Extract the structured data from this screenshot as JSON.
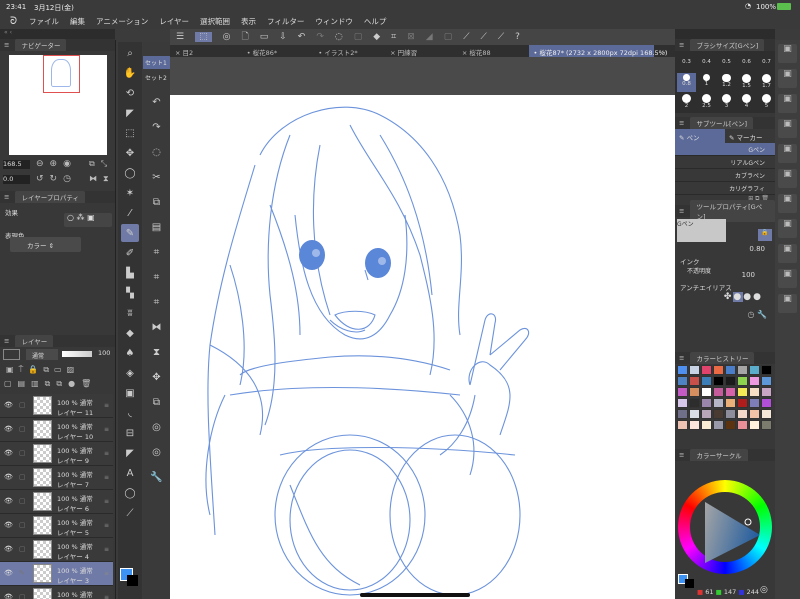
{
  "status": {
    "time": "23:41",
    "date": "3月12日(金)",
    "battery": "100%"
  },
  "menu": [
    "ファイル",
    "編集",
    "アニメーション",
    "レイヤー",
    "選択範囲",
    "表示",
    "フィルター",
    "ウィンドウ",
    "ヘルプ"
  ],
  "tabs": [
    {
      "label": "目2",
      "close": "×"
    },
    {
      "label": "桜花86*",
      "close": "•"
    },
    {
      "label": "イラスト2*",
      "close": "•"
    },
    {
      "label": "円練習",
      "close": "×"
    },
    {
      "label": "桜花88",
      "close": "×"
    },
    {
      "label": "桜花87* (2732 x 2800px 72dpi 168.5%)",
      "close": "•",
      "active": true
    }
  ],
  "navigator": {
    "title": "ナビゲーター",
    "zoom": "168.5",
    "angle": "0.0"
  },
  "layer_property": {
    "title": "レイヤープロパティ",
    "effect_label": "効果",
    "color_label": "表現色",
    "color_value": "カラー"
  },
  "layers_panel": {
    "title": "レイヤー",
    "blend": "通常",
    "opacity": "100",
    "layers": [
      {
        "mode": "100 % 通常",
        "name": "レイヤー 11"
      },
      {
        "mode": "100 % 通常",
        "name": "レイヤー 10"
      },
      {
        "mode": "100 % 通常",
        "name": "レイヤー 9"
      },
      {
        "mode": "100 % 通常",
        "name": "レイヤー 7"
      },
      {
        "mode": "100 % 通常",
        "name": "レイヤー 6"
      },
      {
        "mode": "100 % 通常",
        "name": "レイヤー 5"
      },
      {
        "mode": "100 % 通常",
        "name": "レイヤー 4"
      },
      {
        "mode": "100 % 通常",
        "name": "レイヤー 3",
        "selected": true
      },
      {
        "mode": "100 % 通常",
        "name": ""
      }
    ]
  },
  "subtool_sets": [
    "セット1",
    "セット2"
  ],
  "brush_size": {
    "title": "ブラシサイズ[Gペン]",
    "sizes": [
      "0.3",
      "0.4",
      "0.5",
      "0.6",
      "0.7",
      "0.8",
      "1",
      "1.2",
      "1.5",
      "1.7",
      "2",
      "2.5",
      "3",
      "4",
      "5"
    ]
  },
  "subtool": {
    "title": "サブツール[ペン]",
    "tab_pen": "ペン",
    "tab_marker": "マーカー",
    "items": [
      "Gペン",
      "リアルGペン",
      "カブラペン",
      "カリグラフィ"
    ]
  },
  "tool_property": {
    "title": "ツールプロパティ[Gペン]",
    "preview_label": "Gペン",
    "size": "0.80",
    "ink_label": "インク",
    "opacity_label": "不透明度",
    "opacity": "100",
    "aa_label": "アンチエイリアス"
  },
  "color_history": {
    "title": "カラーヒストリー",
    "colors": [
      "#4f8ff0",
      "#c9d3e6",
      "#e0446d",
      "#ea6a45",
      "#4a7ec9",
      "#a6a6a6",
      "#5aaecb",
      "#000000",
      "#4f82c2",
      "#c8504a",
      "#3c7eb7",
      "#000000",
      "#1b1b1b",
      "#8ed34e",
      "#ee9ae0",
      "#5f98d8",
      "#c45ac4",
      "#d88f5f",
      "#ffffff",
      "#c45b9a",
      "#d463a7",
      "#f4ea55",
      "#f6dfc4",
      "#c9a7c4",
      "#d7c8ec",
      "#2d2d2d",
      "#9a86aa",
      "#b5b5c8",
      "#e9b07a",
      "#b01d1d",
      "#7d7db8",
      "#b24fd8",
      "#6f6f8a",
      "#dadde6",
      "#b9a6b8",
      "#4a3b32",
      "#8d8d9c",
      "#f4d9c8",
      "#f3c3a8",
      "#f6e8d8",
      "#efc3b3",
      "#fae4dc",
      "#f8ecd5",
      "#9999aa",
      "#5b3310",
      "#e88f98",
      "#fff2dc",
      "#7b7b6e"
    ]
  },
  "color_circle": {
    "title": "カラーサークル",
    "r": "61",
    "g": "147",
    "b": "244",
    "main": "#3d93f4",
    "sub": "#000000"
  }
}
